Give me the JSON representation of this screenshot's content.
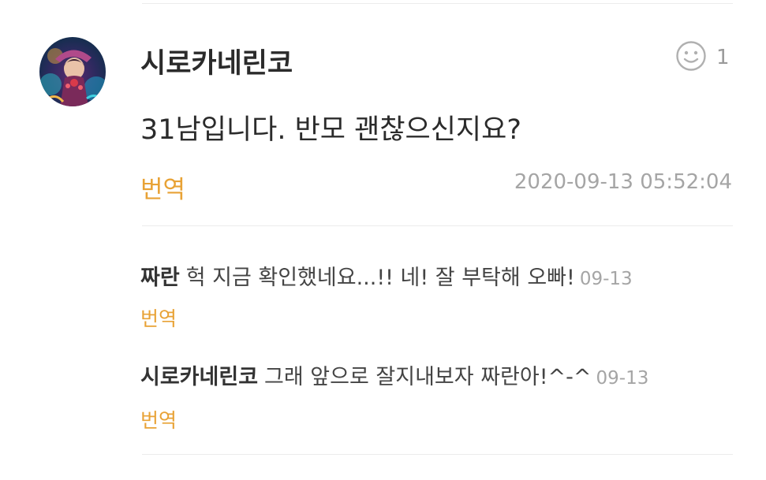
{
  "comment": {
    "author": "시로카네린코",
    "text": "31남입니다. 반모 괜찮으신지요?",
    "translate_label": "번역",
    "timestamp": "2020-09-13 05:52:04",
    "like_count": "1",
    "like_icon": "smiley-face-icon"
  },
  "replies": [
    {
      "author": "짜란",
      "text": "헉 지금 확인했네요...!! 네! 잘 부탁해 오빠!",
      "time": "09-13",
      "translate_label": "번역"
    },
    {
      "author": "시로카네린코",
      "text": "그래 앞으로 잘지내보자 짜란아!^-^",
      "time": "09-13",
      "translate_label": "번역"
    }
  ],
  "colors": {
    "accent": "#e8a235",
    "timestamp": "#a5a5a5",
    "text": "#2b2b2b",
    "divider": "#ececec"
  }
}
